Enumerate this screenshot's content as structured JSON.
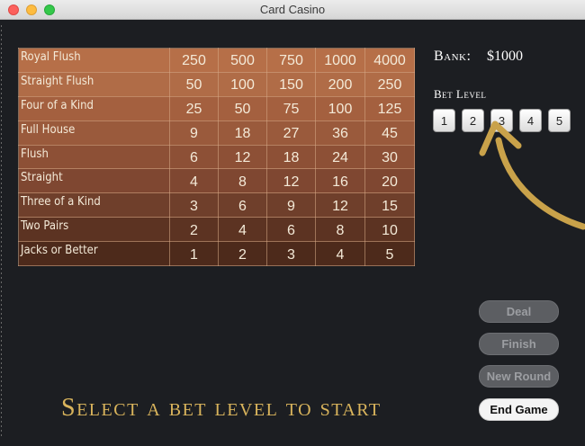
{
  "window": {
    "title": "Card Casino"
  },
  "paytable": {
    "row_colors": [
      "#b66f48",
      "#b06c47",
      "#a4603f",
      "#9a5a3c",
      "#8d5036",
      "#7f4731",
      "#6f3f2b",
      "#5c3322",
      "#4d2a1b"
    ],
    "rows": [
      {
        "hand": "Royal Flush",
        "payouts": [
          "250",
          "500",
          "750",
          "1000",
          "4000"
        ]
      },
      {
        "hand": "Straight Flush",
        "payouts": [
          "50",
          "100",
          "150",
          "200",
          "250"
        ]
      },
      {
        "hand": "Four of a Kind",
        "payouts": [
          "25",
          "50",
          "75",
          "100",
          "125"
        ]
      },
      {
        "hand": "Full House",
        "payouts": [
          "9",
          "18",
          "27",
          "36",
          "45"
        ]
      },
      {
        "hand": "Flush",
        "payouts": [
          "6",
          "12",
          "18",
          "24",
          "30"
        ]
      },
      {
        "hand": "Straight",
        "payouts": [
          "4",
          "8",
          "12",
          "16",
          "20"
        ]
      },
      {
        "hand": "Three of a Kind",
        "payouts": [
          "3",
          "6",
          "9",
          "12",
          "15"
        ]
      },
      {
        "hand": "Two Pairs",
        "payouts": [
          "2",
          "4",
          "6",
          "8",
          "10"
        ]
      },
      {
        "hand": "Jacks or Better",
        "payouts": [
          "1",
          "2",
          "3",
          "4",
          "5"
        ]
      }
    ]
  },
  "bank": {
    "label": "Bank:",
    "value": "$1000"
  },
  "bet_level": {
    "label": "Bet Level",
    "options": [
      "1",
      "2",
      "3",
      "4",
      "5"
    ]
  },
  "actions": {
    "deal": "Deal",
    "finish": "Finish",
    "new_round": "New Round",
    "end_game": "End Game"
  },
  "status_message": "Select a bet level to start",
  "colors": {
    "background": "#1c1e22",
    "gold": "#d9b45c",
    "arrow": "#c9a24a"
  },
  "icons": {
    "pointer": "curved-arrow-icon"
  }
}
